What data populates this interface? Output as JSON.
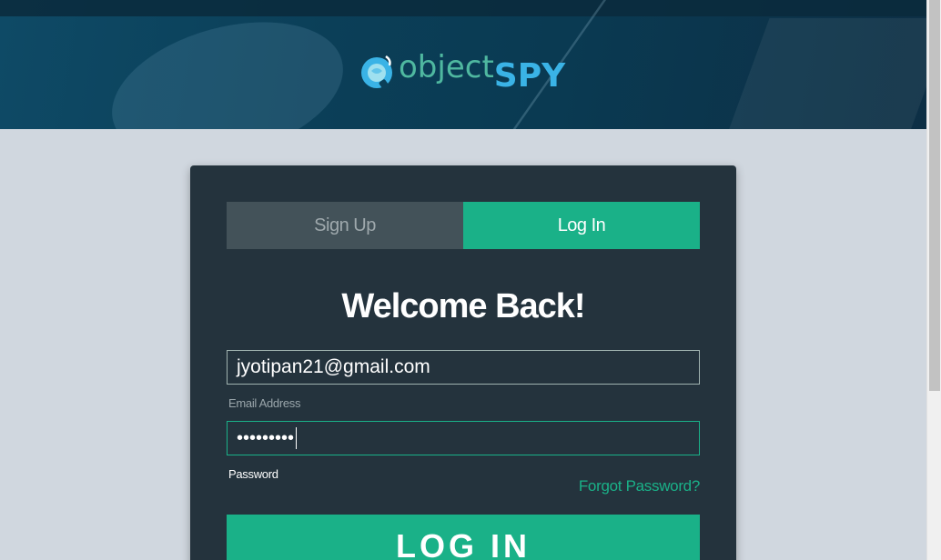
{
  "header": {
    "logo_word1": "object",
    "logo_word2": "SPY"
  },
  "tabs": {
    "signup_label": "Sign Up",
    "login_label": "Log In",
    "active": "Log In"
  },
  "form": {
    "title": "Welcome Back!",
    "email_value": "jyotipan21@gmail.com",
    "email_label": "Email Address",
    "password_value": "•••••••••",
    "password_label": "Password",
    "forgot_label": "Forgot Password?",
    "submit_label": "LOG IN"
  },
  "colors": {
    "accent": "#1ab188",
    "card": "#24333d",
    "page_bg": "#d0d7df",
    "logo_teal": "#4fb8a0",
    "logo_blue": "#3ab3e6"
  }
}
